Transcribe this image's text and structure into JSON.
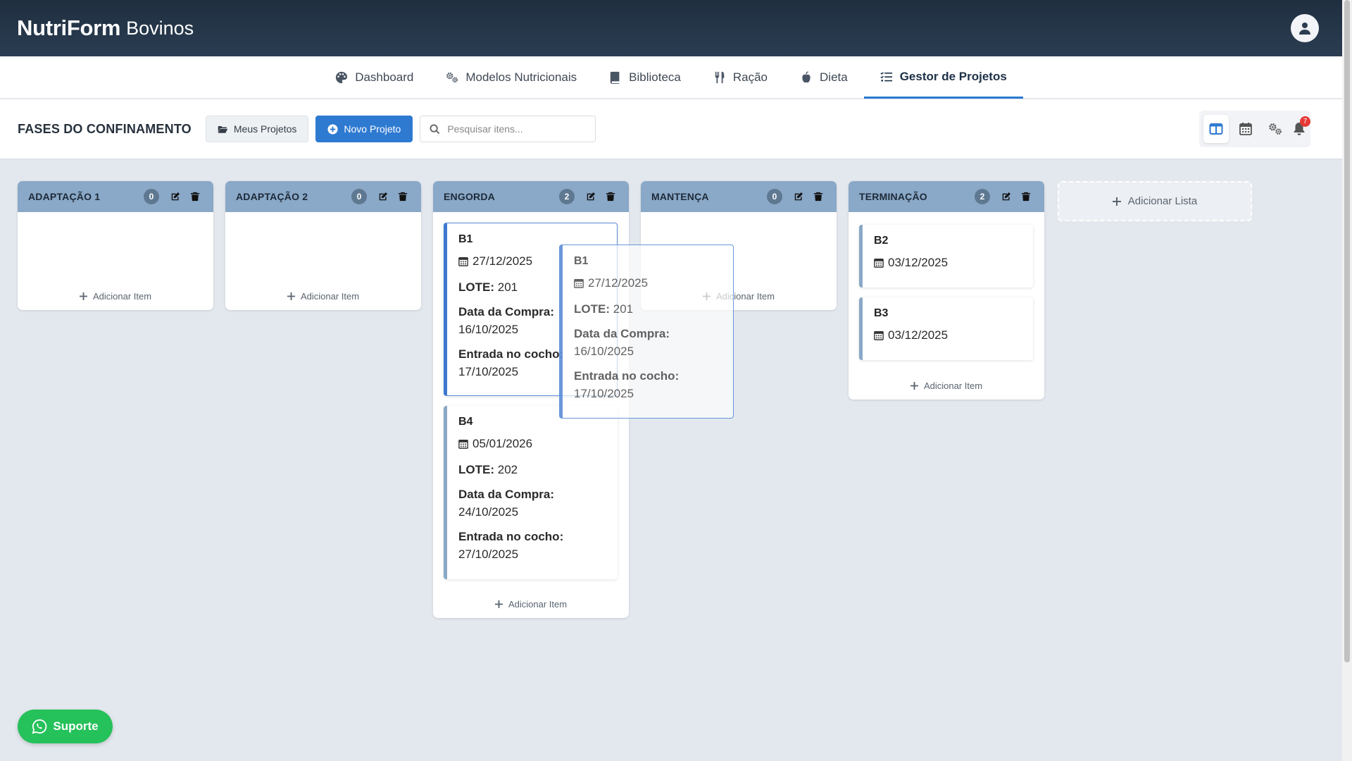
{
  "app": {
    "brand": "NutriForm",
    "brand_sub": "Bovinos"
  },
  "nav": {
    "tabs": [
      {
        "label": "Dashboard",
        "icon": "palette-icon"
      },
      {
        "label": "Modelos Nutricionais",
        "icon": "gears-icon"
      },
      {
        "label": "Biblioteca",
        "icon": "book-icon"
      },
      {
        "label": "Ração",
        "icon": "utensils-icon"
      },
      {
        "label": "Dieta",
        "icon": "apple-icon"
      },
      {
        "label": "Gestor de Projetos",
        "icon": "tasks-icon",
        "active": true
      }
    ]
  },
  "toolbar": {
    "title": "FASES DO CONFINAMENTO",
    "my_projects": "Meus Projetos",
    "new_project": "Novo Projeto",
    "search_placeholder": "Pesquisar itens...",
    "notification_count": "7"
  },
  "columns": [
    {
      "title": "ADAPTAÇÃO 1",
      "count": "0",
      "add_label": "Adicionar Item"
    },
    {
      "title": "ADAPTAÇÃO 2",
      "count": "0",
      "add_label": "Adicionar Item"
    },
    {
      "title": "ENGORDA",
      "count": "2",
      "add_label": "Adicionar Item",
      "cards": [
        {
          "title": "B1",
          "date": "27/12/2025",
          "lote_label": "LOTE:",
          "lote": "201",
          "compra_label": "Data da Compra:",
          "compra": "16/10/2025",
          "entrada_label": "Entrada no cocho:",
          "entrada": "17/10/2025"
        },
        {
          "title": "B4",
          "date": "05/01/2026",
          "lote_label": "LOTE:",
          "lote": "202",
          "compra_label": "Data da Compra:",
          "compra": "24/10/2025",
          "entrada_label": "Entrada no cocho:",
          "entrada": "27/10/2025"
        }
      ]
    },
    {
      "title": "MANTENÇA",
      "count": "0",
      "add_label": "Adicionar Item"
    },
    {
      "title": "TERMINAÇÃO",
      "count": "2",
      "add_label": "Adicionar Item",
      "cards": [
        {
          "title": "B2",
          "date": "03/12/2025"
        },
        {
          "title": "B3",
          "date": "03/12/2025"
        }
      ]
    }
  ],
  "add_list_label": "Adicionar Lista",
  "drag_ghost": {
    "title": "B1",
    "date": "27/12/2025",
    "lote_label": "LOTE:",
    "lote": "201",
    "compra_label": "Data da Compra:",
    "compra": "16/10/2025",
    "entrada_label": "Entrada no cocho:",
    "entrada": "17/10/2025"
  },
  "support_label": "Suporte",
  "colors": {
    "header": "#1f2f40",
    "accent": "#2f7ad1",
    "column_head": "#8aa8c7",
    "support": "#25c15a"
  }
}
